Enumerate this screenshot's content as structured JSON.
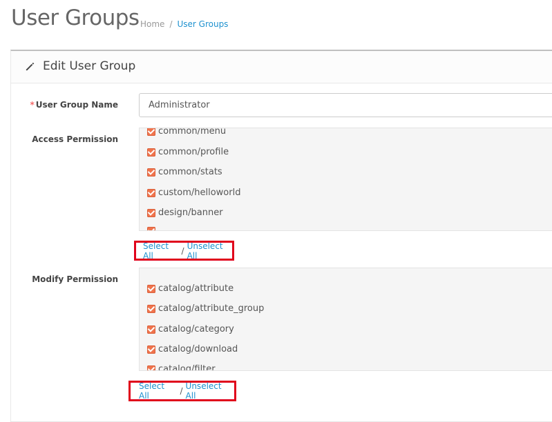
{
  "header": {
    "title": "User Groups",
    "breadcrumb": {
      "home": "Home",
      "separator": "/",
      "current": "User Groups"
    }
  },
  "panel": {
    "title": "Edit User Group",
    "icon": "pencil-icon"
  },
  "form": {
    "name_label_required": "*",
    "name_label": "User Group Name",
    "name_value": "Administrator",
    "access_label": "Access Permission",
    "modify_label": "Modify Permission",
    "access_items": [
      "common/menu",
      "common/profile",
      "common/stats",
      "custom/helloworld",
      "design/banner"
    ],
    "modify_items": [
      "catalog/attribute",
      "catalog/attribute_group",
      "catalog/category",
      "catalog/download",
      "catalog/filter"
    ],
    "select_all": "Select All",
    "slash": "/",
    "unselect_all": "Unselect All"
  },
  "colors": {
    "link": "#1e91cf",
    "highlight_border": "#e0001b",
    "checkbox": "#f0744d"
  }
}
